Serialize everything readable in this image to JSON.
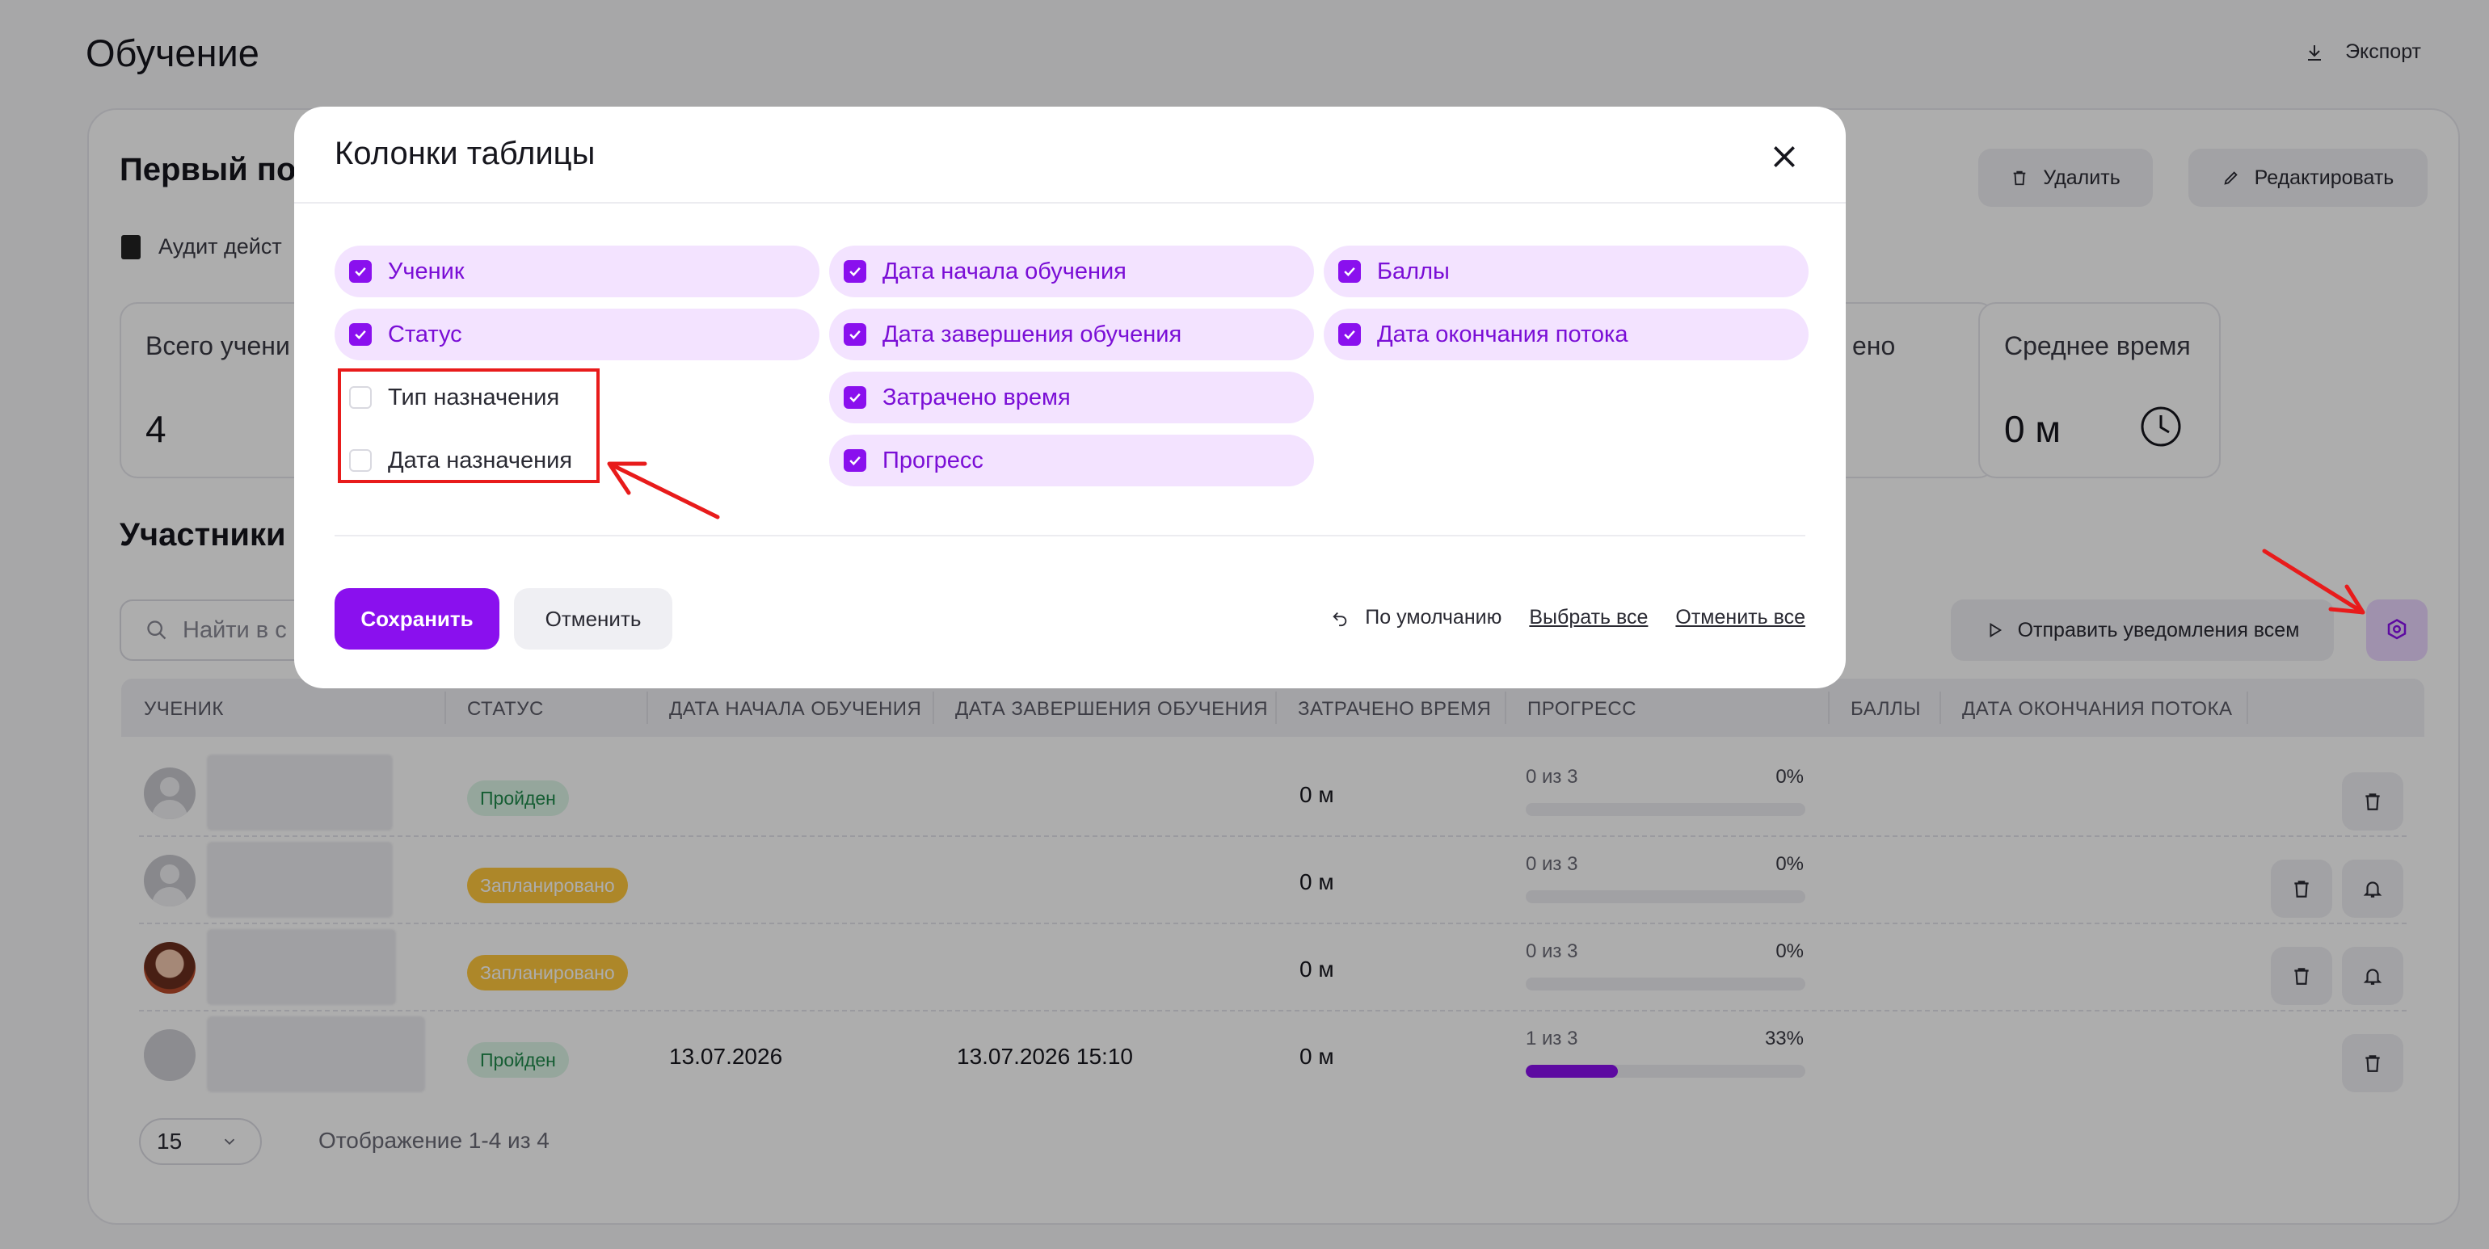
{
  "page": {
    "title": "Обучение",
    "export_label": "Экспорт"
  },
  "flow": {
    "title": "Первый по",
    "delete_label": "Удалить",
    "edit_label": "Редактировать",
    "audit_label": "Аудит дейст"
  },
  "stats": [
    {
      "label": "Всего учени",
      "value": "4"
    },
    {
      "label": "ено",
      "value": ""
    },
    {
      "label": "Среднее время",
      "value": "0 м"
    }
  ],
  "participants": {
    "title": "Участники",
    "search_placeholder": "Найти в с",
    "notify_all_label": "Отправить уведомления всем"
  },
  "table": {
    "headers": [
      "УЧЕНИК",
      "СТАТУС",
      "ДАТА НАЧАЛА ОБУЧЕНИЯ",
      "ДАТА ЗАВЕРШЕНИЯ ОБУЧЕНИЯ",
      "ЗАТРАЧЕНО ВРЕМЯ",
      "ПРОГРЕСС",
      "БАЛЛЫ",
      "ДАТА ОКОНЧАНИЯ ПОТОКА"
    ],
    "rows": [
      {
        "status": "Пройден",
        "status_kind": "ok",
        "start": "",
        "end": "",
        "time": "0 м",
        "progress_text": "0 из 3",
        "progress_pct": "0%",
        "progress": 0
      },
      {
        "status": "Запланировано",
        "status_kind": "plan",
        "start": "",
        "end": "",
        "time": "0 м",
        "progress_text": "0 из 3",
        "progress_pct": "0%",
        "progress": 0
      },
      {
        "status": "Запланировано",
        "status_kind": "plan",
        "start": "",
        "end": "",
        "time": "0 м",
        "progress_text": "0 из 3",
        "progress_pct": "0%",
        "progress": 0
      },
      {
        "status": "Пройден",
        "status_kind": "ok",
        "start": "13.07.2026",
        "end": "13.07.2026 15:10",
        "time": "0 м",
        "progress_text": "1 из 3",
        "progress_pct": "33%",
        "progress": 0.33
      }
    ],
    "page_size": "15",
    "showing": "Отображение 1-4 из 4"
  },
  "modal": {
    "title": "Колонки таблицы",
    "columns": [
      {
        "label": "Ученик",
        "checked": true
      },
      {
        "label": "Дата начала обучения",
        "checked": true
      },
      {
        "label": "Баллы",
        "checked": true
      },
      {
        "label": "Статус",
        "checked": true
      },
      {
        "label": "Дата завершения обучения",
        "checked": true
      },
      {
        "label": "Дата окончания потока",
        "checked": true
      },
      {
        "label": "Тип назначения",
        "checked": false
      },
      {
        "label": "Затрачено время",
        "checked": true
      },
      {
        "label": "Дата назначения",
        "checked": false
      },
      {
        "label": "Прогресс",
        "checked": true
      }
    ],
    "save_label": "Сохранить",
    "cancel_label": "Отменить",
    "default_label": "По умолчанию",
    "select_all_label": "Выбрать все",
    "deselect_all_label": "Отменить все"
  },
  "colors": {
    "accent": "#8a10ee",
    "annotation": "#e81b1b"
  }
}
